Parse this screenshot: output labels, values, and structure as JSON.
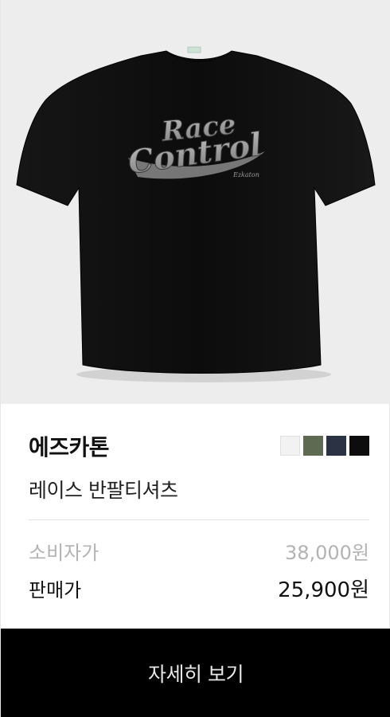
{
  "product": {
    "brand": "에즈카톤",
    "name": "레이스 반팔티셔츠",
    "list_price_label": "소비자가",
    "list_price": "38,000원",
    "sale_price_label": "판매가",
    "sale_price": "25,900원",
    "graphic_text_line1": "Race",
    "graphic_text_line2": "Control",
    "graphic_signature": "Ezkaton"
  },
  "swatches": [
    {
      "color": "#f2f2f2",
      "name": "white"
    },
    {
      "color": "#5e6b52",
      "name": "khaki"
    },
    {
      "color": "#2b3243",
      "name": "navy"
    },
    {
      "color": "#0d0d0d",
      "name": "black"
    }
  ],
  "cta": {
    "label": "자세히 보기"
  }
}
